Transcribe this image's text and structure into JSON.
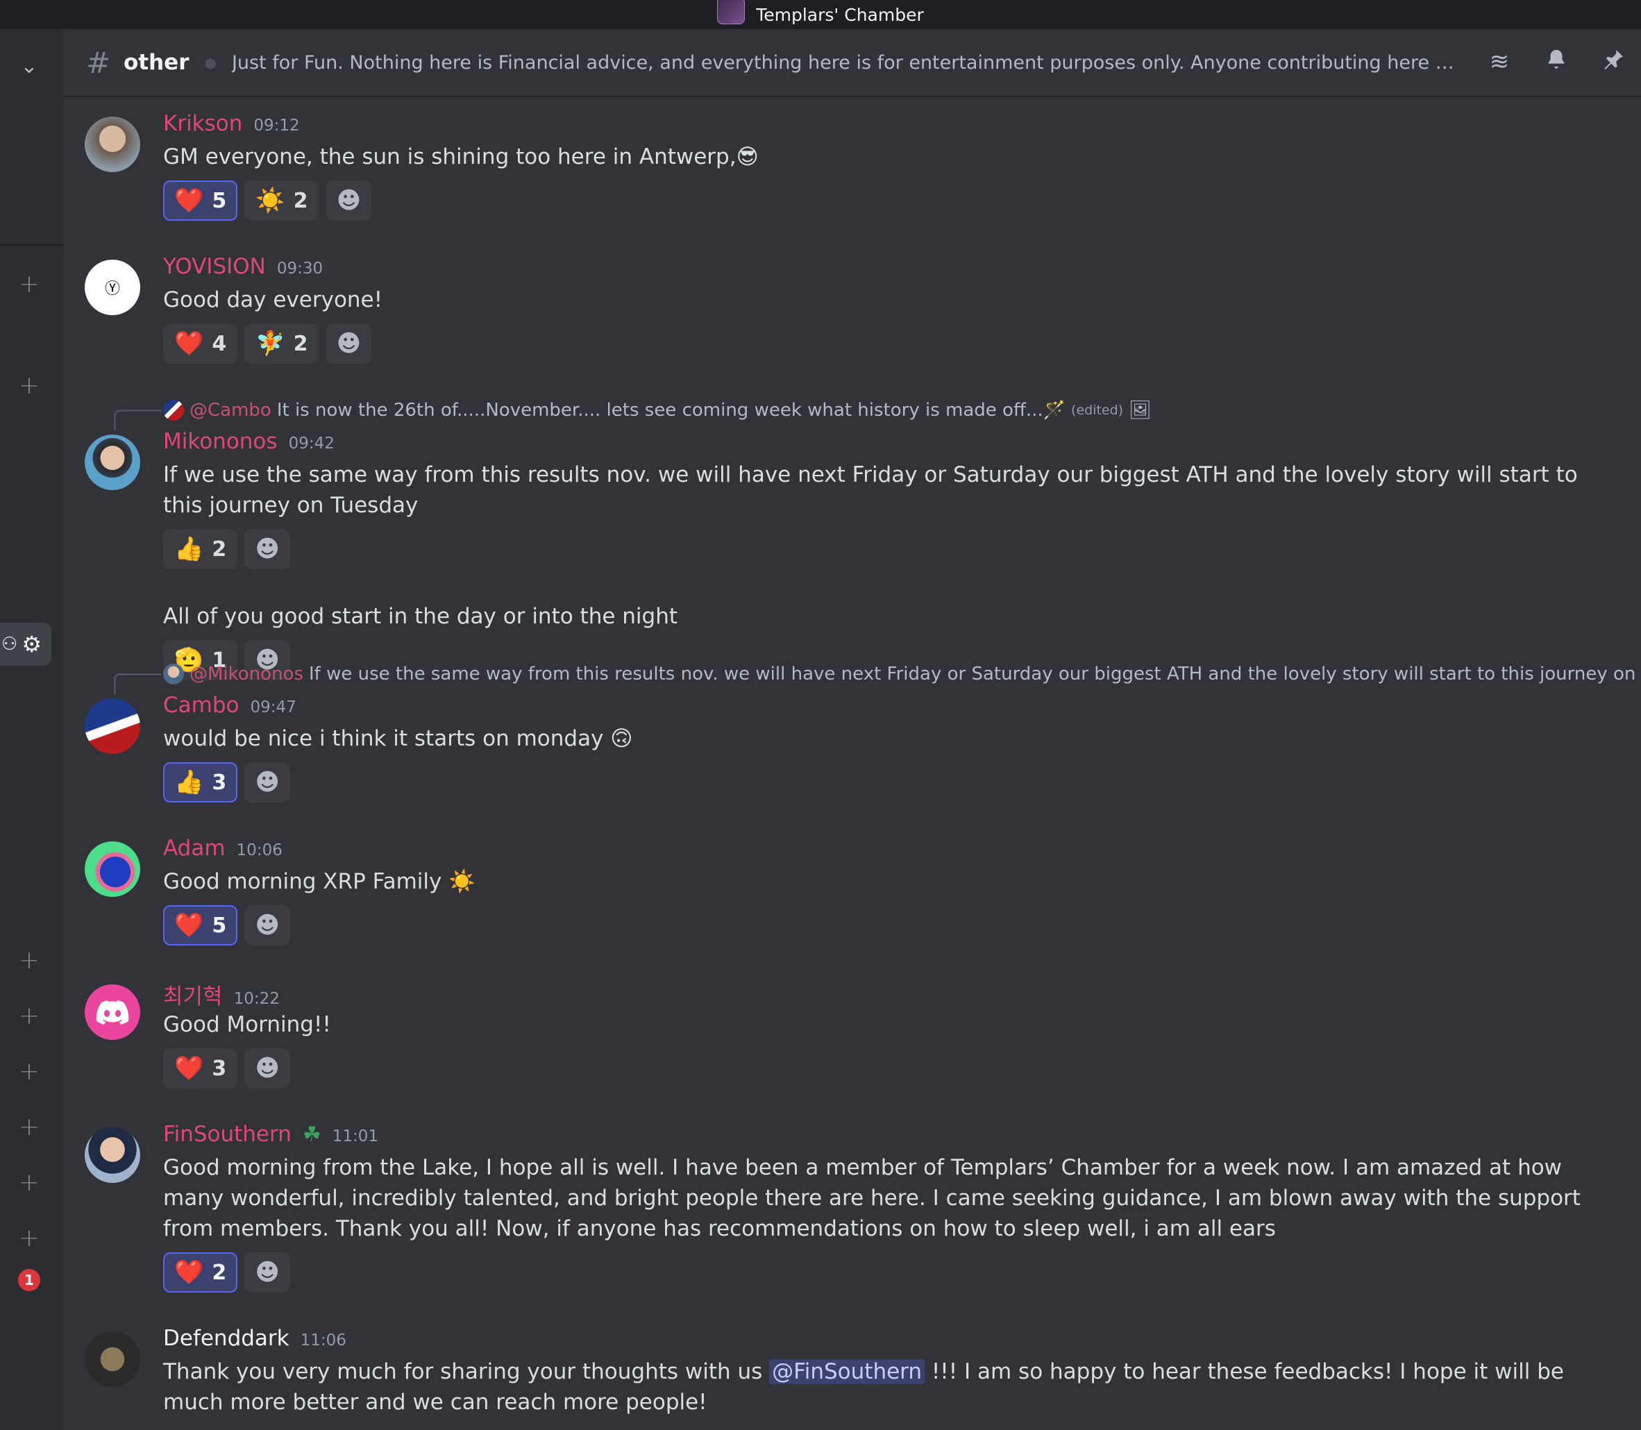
{
  "window": {
    "title": "Templars' Chamber"
  },
  "header": {
    "channel": "other",
    "topic": "Just for Fun. Nothing here is Financial advice, and everything here is for entertainment purposes only. Anyone contributing here accepts these ter…"
  },
  "sidebar": {
    "badge": "1"
  },
  "messages": [
    {
      "author": "Krikson",
      "time": "09:12",
      "text": "GM everyone, the sun is shining too here in Antwerp,😎",
      "reactions": [
        {
          "emoji": "❤️",
          "count": "5",
          "me": true
        },
        {
          "emoji": "☀️",
          "count": "2",
          "me": false
        }
      ]
    },
    {
      "author": "YOVISION",
      "time": "09:30",
      "text": "Good day everyone!",
      "reactions": [
        {
          "emoji": "❤️",
          "count": "4",
          "me": false
        },
        {
          "emoji": "🧚",
          "count": "2",
          "me": false
        }
      ]
    },
    {
      "author": "Mikononos",
      "time": "09:42",
      "reply": {
        "name": "@Cambo",
        "text": "It is now the 26th of.....November.... lets see coming week what history is made off...🪄",
        "edited": "(edited)"
      },
      "text": "If we use the same way from this results nov. we will have next Friday or Saturday our biggest ATH and the lovely story will start to this journey on Tuesday",
      "reactions": [
        {
          "emoji": "👍",
          "count": "2",
          "me": false
        }
      ],
      "text2": "All of you good start in the day or into the night",
      "reactions2": [
        {
          "emoji": "🫡",
          "count": "1",
          "me": false
        }
      ]
    },
    {
      "author": "Cambo",
      "time": "09:47",
      "reply": {
        "name": "@Mikononos",
        "text": "If we use the same way from this results nov. we will have next Friday or Saturday our biggest ATH and the lovely story will start to this journey on Tuesday"
      },
      "text": "would be nice i think it starts on monday 🙃",
      "reactions": [
        {
          "emoji": "👍",
          "count": "3",
          "me": true
        }
      ]
    },
    {
      "author": "Adam",
      "time": "10:06",
      "text": "Good morning XRP Family ☀️",
      "reactions": [
        {
          "emoji": "❤️",
          "count": "5",
          "me": true
        }
      ]
    },
    {
      "author": "최기혁",
      "time": "10:22",
      "text": "Good Morning!!",
      "reactions": [
        {
          "emoji": "❤️",
          "count": "3",
          "me": false
        }
      ]
    },
    {
      "author": "FinSouthern",
      "time": "11:01",
      "text": "Good morning from the Lake, I hope all is well. I have been a member of Templars’ Chamber for a week now. I am amazed at how many wonderful, incredibly talented, and bright people there are here. I came seeking guidance, I am blown away with the support from members. Thank you all! Now, if anyone has recommendations on how to sleep well, i am all ears",
      "reactions": [
        {
          "emoji": "❤️",
          "count": "2",
          "me": true
        }
      ]
    },
    {
      "author": "Defenddark",
      "time": "11:06",
      "text_before": "Thank you very much for sharing your thoughts with us",
      "mention": "@FinSouthern",
      "text_after": "!!! I am so happy to hear these feedbacks! I hope it will be much more better and we can reach more people!"
    }
  ],
  "icons": {
    "hash": "#",
    "chevron": "⌄",
    "plus": "+",
    "gear": "⚙",
    "bell": "🔔",
    "pin": "📌",
    "threads": "≋",
    "add_reaction": "☻",
    "image": "🖼"
  }
}
